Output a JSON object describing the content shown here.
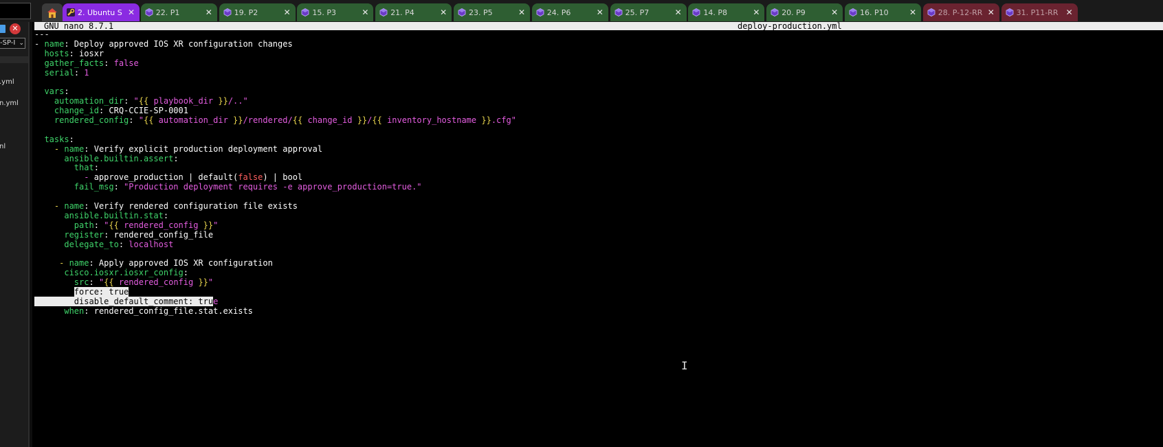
{
  "tabs": [
    {
      "label": "2. Ubuntu S",
      "icon": "terminal-wrench-icon",
      "variant": "active"
    },
    {
      "label": "22. P1",
      "icon": "hexagon-icon",
      "variant": "green"
    },
    {
      "label": "19. P2",
      "icon": "hexagon-icon",
      "variant": "green"
    },
    {
      "label": "15. P3",
      "icon": "hexagon-icon",
      "variant": "green"
    },
    {
      "label": "21. P4",
      "icon": "hexagon-icon",
      "variant": "green"
    },
    {
      "label": "23. P5",
      "icon": "hexagon-icon",
      "variant": "green"
    },
    {
      "label": "24. P6",
      "icon": "hexagon-icon",
      "variant": "green"
    },
    {
      "label": "25. P7",
      "icon": "hexagon-icon",
      "variant": "green"
    },
    {
      "label": "14. P8",
      "icon": "hexagon-icon",
      "variant": "green"
    },
    {
      "label": "20. P9",
      "icon": "hexagon-icon",
      "variant": "green"
    },
    {
      "label": "16. P10",
      "icon": "hexagon-icon",
      "variant": "green"
    },
    {
      "label": "28. P-12-RR",
      "icon": "hexagon-icon",
      "variant": "red"
    },
    {
      "label": "31. P11-RR",
      "icon": "hexagon-icon",
      "variant": "red"
    }
  ],
  "tab_close_glyph": "✕",
  "sidebar": {
    "dropdown_value": "-SP-I",
    "files": [
      ".yml",
      "n.yml",
      "nl"
    ]
  },
  "nano": {
    "version": "GNU nano 8.7.1",
    "filename": "deploy-production.yml"
  },
  "editor_lines": [
    [
      [
        "c-dash",
        "---"
      ]
    ],
    [
      [
        "c-dash",
        "- "
      ],
      [
        "c-key",
        "name"
      ],
      [
        "c-val",
        ": Deploy approved IOS XR configuration changes"
      ]
    ],
    [
      [
        "c-val",
        "  "
      ],
      [
        "c-key",
        "hosts"
      ],
      [
        "c-val",
        ": iosxr"
      ]
    ],
    [
      [
        "c-val",
        "  "
      ],
      [
        "c-key",
        "gather_facts"
      ],
      [
        "c-val",
        ": "
      ],
      [
        "c-str",
        "false"
      ]
    ],
    [
      [
        "c-val",
        "  "
      ],
      [
        "c-key",
        "serial"
      ],
      [
        "c-val",
        ": "
      ],
      [
        "c-str",
        "1"
      ]
    ],
    [],
    [
      [
        "c-val",
        "  "
      ],
      [
        "c-key",
        "vars"
      ],
      [
        "c-val",
        ":"
      ]
    ],
    [
      [
        "c-val",
        "    "
      ],
      [
        "c-key",
        "automation_dir"
      ],
      [
        "c-val",
        ": "
      ],
      [
        "c-str",
        "\""
      ],
      [
        "c-tpl",
        "{{ "
      ],
      [
        "c-str",
        "playbook_dir"
      ],
      [
        "c-tpl",
        " }}"
      ],
      [
        "c-str",
        "/..\""
      ]
    ],
    [
      [
        "c-val",
        "    "
      ],
      [
        "c-key",
        "change_id"
      ],
      [
        "c-val",
        ": CRQ-CCIE-SP-0001"
      ]
    ],
    [
      [
        "c-val",
        "    "
      ],
      [
        "c-key",
        "rendered_config"
      ],
      [
        "c-val",
        ": "
      ],
      [
        "c-str",
        "\""
      ],
      [
        "c-tpl",
        "{{ "
      ],
      [
        "c-str",
        "automation_dir"
      ],
      [
        "c-tpl",
        " }}"
      ],
      [
        "c-str",
        "/rendered/"
      ],
      [
        "c-tpl",
        "{{ "
      ],
      [
        "c-str",
        "change_id"
      ],
      [
        "c-tpl",
        " }}"
      ],
      [
        "c-str",
        "/"
      ],
      [
        "c-tpl",
        "{{ "
      ],
      [
        "c-str",
        "inventory_hostname"
      ],
      [
        "c-tpl",
        " }}"
      ],
      [
        "c-str",
        ".cfg\""
      ]
    ],
    [],
    [
      [
        "c-val",
        "  "
      ],
      [
        "c-key",
        "tasks"
      ],
      [
        "c-val",
        ":"
      ]
    ],
    [
      [
        "c-val",
        "    "
      ],
      [
        "c-tpl",
        "- "
      ],
      [
        "c-key",
        "name"
      ],
      [
        "c-val",
        ": Verify explicit production deployment approval"
      ]
    ],
    [
      [
        "c-val",
        "      "
      ],
      [
        "c-key",
        "ansible.builtin.assert"
      ],
      [
        "c-val",
        ":"
      ]
    ],
    [
      [
        "c-val",
        "        "
      ],
      [
        "c-key",
        "that"
      ],
      [
        "c-val",
        ":"
      ]
    ],
    [
      [
        "c-val",
        "          "
      ],
      [
        "c-str",
        "- "
      ],
      [
        "c-val",
        "approve_production | default("
      ],
      [
        "c-bool",
        "false"
      ],
      [
        "c-val",
        ") | bool"
      ]
    ],
    [
      [
        "c-val",
        "        "
      ],
      [
        "c-key",
        "fail_msg"
      ],
      [
        "c-val",
        ": "
      ],
      [
        "c-str",
        "\"Production deployment requires -e approve_production=true.\""
      ]
    ],
    [],
    [
      [
        "c-val",
        "    "
      ],
      [
        "c-tpl",
        "- "
      ],
      [
        "c-key",
        "name"
      ],
      [
        "c-val",
        ": Verify rendered configuration file exists"
      ]
    ],
    [
      [
        "c-val",
        "      "
      ],
      [
        "c-key",
        "ansible.builtin.stat"
      ],
      [
        "c-val",
        ":"
      ]
    ],
    [
      [
        "c-val",
        "        "
      ],
      [
        "c-key",
        "path"
      ],
      [
        "c-val",
        ": "
      ],
      [
        "c-str",
        "\""
      ],
      [
        "c-tpl",
        "{{ "
      ],
      [
        "c-str",
        "rendered_config"
      ],
      [
        "c-tpl",
        " }}"
      ],
      [
        "c-str",
        "\""
      ]
    ],
    [
      [
        "c-val",
        "      "
      ],
      [
        "c-key",
        "register"
      ],
      [
        "c-val",
        ": rendered_config_file"
      ]
    ],
    [
      [
        "c-val",
        "      "
      ],
      [
        "c-key",
        "delegate_to"
      ],
      [
        "c-val",
        ": "
      ],
      [
        "c-str",
        "localhost"
      ]
    ],
    [],
    [
      [
        "c-val",
        "     "
      ],
      [
        "c-tpl",
        "- "
      ],
      [
        "c-key",
        "name"
      ],
      [
        "c-val",
        ": Apply approved IOS XR configuration"
      ]
    ],
    [
      [
        "c-val",
        "      "
      ],
      [
        "c-key",
        "cisco.iosxr.iosxr_config"
      ],
      [
        "c-val",
        ":"
      ]
    ],
    [
      [
        "c-val",
        "        "
      ],
      [
        "c-key",
        "src"
      ],
      [
        "c-val",
        ": "
      ],
      [
        "c-str",
        "\""
      ],
      [
        "c-tpl",
        "{{ "
      ],
      [
        "c-str",
        "rendered_config"
      ],
      [
        "c-tpl",
        " }}"
      ],
      [
        "c-str",
        "\""
      ]
    ],
    [
      [
        "c-val",
        "        "
      ],
      [
        "sel",
        "force: true"
      ]
    ],
    [
      [
        "sel",
        "        disable_default_comment: tru"
      ],
      [
        "c-str",
        "e"
      ]
    ],
    [
      [
        "c-val",
        "      "
      ],
      [
        "c-key",
        "when"
      ],
      [
        "c-val",
        ": rendered_config_file.stat.exists"
      ]
    ]
  ]
}
